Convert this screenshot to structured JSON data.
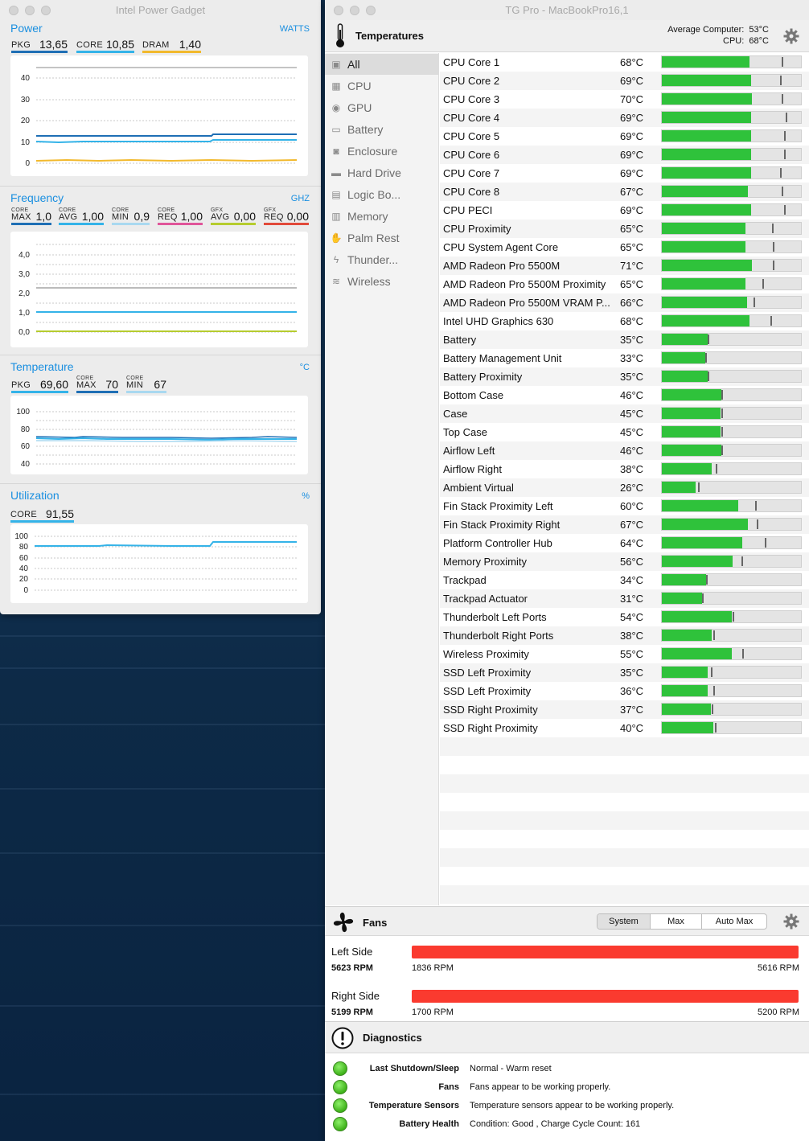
{
  "ipg": {
    "title": "Intel Power Gadget",
    "power": {
      "title": "Power",
      "unit": "WATTS",
      "metrics": [
        {
          "label": "PKG",
          "value": "13,65",
          "color": "#1f6fb5"
        },
        {
          "label": "CORE",
          "value": "10,85",
          "color": "#34b3e8"
        },
        {
          "label": "DRAM",
          "value": "1,40",
          "color": "#f2b92d"
        }
      ],
      "yticks": [
        "40",
        "30",
        "20",
        "10",
        "0"
      ]
    },
    "frequency": {
      "title": "Frequency",
      "unit": "GHZ",
      "metrics": [
        {
          "small": "CORE",
          "label": "MAX",
          "value": "1,0",
          "color": "#1f6fb5"
        },
        {
          "small": "CORE",
          "label": "AVG",
          "value": "1,00",
          "color": "#34b3e8"
        },
        {
          "small": "CORE",
          "label": "MIN",
          "value": "0,9",
          "color": "#a9d8f0"
        },
        {
          "small": "CORE",
          "label": "REQ",
          "value": "1,00",
          "color": "#e0559a"
        },
        {
          "small": "GFX",
          "label": "AVG",
          "value": "0,00",
          "color": "#b6cc2f"
        },
        {
          "small": "GFX",
          "label": "REQ",
          "value": "0,00",
          "color": "#e24a3a"
        }
      ],
      "yticks": [
        "4,0",
        "3,0",
        "2,0",
        "1,0",
        "0,0"
      ]
    },
    "temperature": {
      "title": "Temperature",
      "unit": "°C",
      "metrics": [
        {
          "label": "PKG",
          "value": "69,60",
          "color": "#34b3e8"
        },
        {
          "small": "CORE",
          "label": "MAX",
          "value": "70",
          "color": "#1f6fb5"
        },
        {
          "small": "CORE",
          "label": "MIN",
          "value": "67",
          "color": "#a9d8f0"
        }
      ],
      "yticks": [
        "100",
        "80",
        "60",
        "40"
      ]
    },
    "utilization": {
      "title": "Utilization",
      "unit": "%",
      "metrics": [
        {
          "label": "CORE",
          "value": "91,55",
          "color": "#34b3e8"
        }
      ],
      "yticks": [
        "100",
        "80",
        "60",
        "40",
        "20",
        "0"
      ]
    }
  },
  "tg": {
    "title": "TG Pro - MacBookPro16,1",
    "header_title": "Temperatures",
    "avg_label": "Average Computer:",
    "avg_value": "53°C",
    "cpu_label": "CPU:",
    "cpu_value": "68°C",
    "sidebar": [
      {
        "label": "All",
        "icon": "all-icon",
        "active": true
      },
      {
        "label": "CPU",
        "icon": "cpu-icon"
      },
      {
        "label": "GPU",
        "icon": "gpu-icon"
      },
      {
        "label": "Battery",
        "icon": "battery-icon"
      },
      {
        "label": "Enclosure",
        "icon": "enclosure-icon"
      },
      {
        "label": "Hard Drive",
        "icon": "hard-drive-icon"
      },
      {
        "label": "Logic Bo...",
        "icon": "logic-board-icon"
      },
      {
        "label": "Memory",
        "icon": "memory-icon"
      },
      {
        "label": "Palm Rest",
        "icon": "palm-rest-icon"
      },
      {
        "label": "Thunder...",
        "icon": "thunderbolt-icon"
      },
      {
        "label": "Wireless",
        "icon": "wireless-icon"
      }
    ],
    "sensors": [
      {
        "name": "CPU Core 1",
        "temp": "68°C",
        "level": 0.63,
        "max": 0.86
      },
      {
        "name": "CPU Core 2",
        "temp": "69°C",
        "level": 0.64,
        "max": 0.85
      },
      {
        "name": "CPU Core 3",
        "temp": "70°C",
        "level": 0.65,
        "max": 0.86
      },
      {
        "name": "CPU Core 4",
        "temp": "69°C",
        "level": 0.64,
        "max": 0.89
      },
      {
        "name": "CPU Core 5",
        "temp": "69°C",
        "level": 0.64,
        "max": 0.88
      },
      {
        "name": "CPU Core 6",
        "temp": "69°C",
        "level": 0.64,
        "max": 0.88
      },
      {
        "name": "CPU Core 7",
        "temp": "69°C",
        "level": 0.64,
        "max": 0.85
      },
      {
        "name": "CPU Core 8",
        "temp": "67°C",
        "level": 0.62,
        "max": 0.86
      },
      {
        "name": "CPU PECI",
        "temp": "69°C",
        "level": 0.64,
        "max": 0.88
      },
      {
        "name": "CPU Proximity",
        "temp": "65°C",
        "level": 0.6,
        "max": 0.79
      },
      {
        "name": "CPU System Agent Core",
        "temp": "65°C",
        "level": 0.6,
        "max": 0.8
      },
      {
        "name": "AMD Radeon Pro 5500M",
        "temp": "71°C",
        "level": 0.65,
        "max": 0.8
      },
      {
        "name": "AMD Radeon Pro 5500M Proximity",
        "temp": "65°C",
        "level": 0.6,
        "max": 0.72
      },
      {
        "name": "AMD Radeon Pro 5500M VRAM P...",
        "temp": "66°C",
        "level": 0.61,
        "max": 0.66
      },
      {
        "name": "Intel UHD Graphics 630",
        "temp": "68°C",
        "level": 0.63,
        "max": 0.78
      },
      {
        "name": "Battery",
        "temp": "35°C",
        "level": 0.33,
        "max": 0.33
      },
      {
        "name": "Battery Management Unit",
        "temp": "33°C",
        "level": 0.31,
        "max": 0.31
      },
      {
        "name": "Battery Proximity",
        "temp": "35°C",
        "level": 0.33,
        "max": 0.33
      },
      {
        "name": "Bottom Case",
        "temp": "46°C",
        "level": 0.43,
        "max": 0.43
      },
      {
        "name": "Case",
        "temp": "45°C",
        "level": 0.42,
        "max": 0.43
      },
      {
        "name": "Top Case",
        "temp": "45°C",
        "level": 0.42,
        "max": 0.43
      },
      {
        "name": "Airflow Left",
        "temp": "46°C",
        "level": 0.43,
        "max": 0.43
      },
      {
        "name": "Airflow Right",
        "temp": "38°C",
        "level": 0.36,
        "max": 0.39
      },
      {
        "name": "Ambient Virtual",
        "temp": "26°C",
        "level": 0.24,
        "max": 0.26
      },
      {
        "name": "Fin Stack Proximity Left",
        "temp": "60°C",
        "level": 0.55,
        "max": 0.67
      },
      {
        "name": "Fin Stack Proximity Right",
        "temp": "67°C",
        "level": 0.62,
        "max": 0.68
      },
      {
        "name": "Platform Controller Hub",
        "temp": "64°C",
        "level": 0.58,
        "max": 0.74
      },
      {
        "name": "Memory Proximity",
        "temp": "56°C",
        "level": 0.51,
        "max": 0.57
      },
      {
        "name": "Trackpad",
        "temp": "34°C",
        "level": 0.32,
        "max": 0.32
      },
      {
        "name": "Trackpad Actuator",
        "temp": "31°C",
        "level": 0.29,
        "max": 0.29
      },
      {
        "name": "Thunderbolt Left Ports",
        "temp": "54°C",
        "level": 0.5,
        "max": 0.51
      },
      {
        "name": "Thunderbolt Right Ports",
        "temp": "38°C",
        "level": 0.36,
        "max": 0.37
      },
      {
        "name": "Wireless Proximity",
        "temp": "55°C",
        "level": 0.5,
        "max": 0.58
      },
      {
        "name": "SSD Left Proximity",
        "temp": "35°C",
        "level": 0.33,
        "max": 0.35
      },
      {
        "name": "SSD Left Proximity",
        "temp": "36°C",
        "level": 0.33,
        "max": 0.37
      },
      {
        "name": "SSD Right Proximity",
        "temp": "37°C",
        "level": 0.35,
        "max": 0.36
      },
      {
        "name": "SSD Right Proximity",
        "temp": "40°C",
        "level": 0.37,
        "max": 0.38
      }
    ],
    "fans": {
      "title": "Fans",
      "modes": [
        "System",
        "Max",
        "Auto Max"
      ],
      "selected_mode": "System",
      "list": [
        {
          "name": "Left Side",
          "rpm": "5623 RPM",
          "min": "1836 RPM",
          "max": "5616 RPM",
          "level": 1.0
        },
        {
          "name": "Right Side",
          "rpm": "5199 RPM",
          "min": "1700 RPM",
          "max": "5200 RPM",
          "level": 1.0
        }
      ]
    },
    "diagnostics": {
      "title": "Diagnostics",
      "items": [
        {
          "key": "Last Shutdown/Sleep",
          "value": "Normal - Warm reset"
        },
        {
          "key": "Fans",
          "value": "Fans appear to be working properly."
        },
        {
          "key": "Temperature Sensors",
          "value": "Temperature sensors appear to be working properly."
        },
        {
          "key": "Battery Health",
          "value": "Condition: Good , Charge Cycle Count: 161"
        }
      ]
    }
  }
}
